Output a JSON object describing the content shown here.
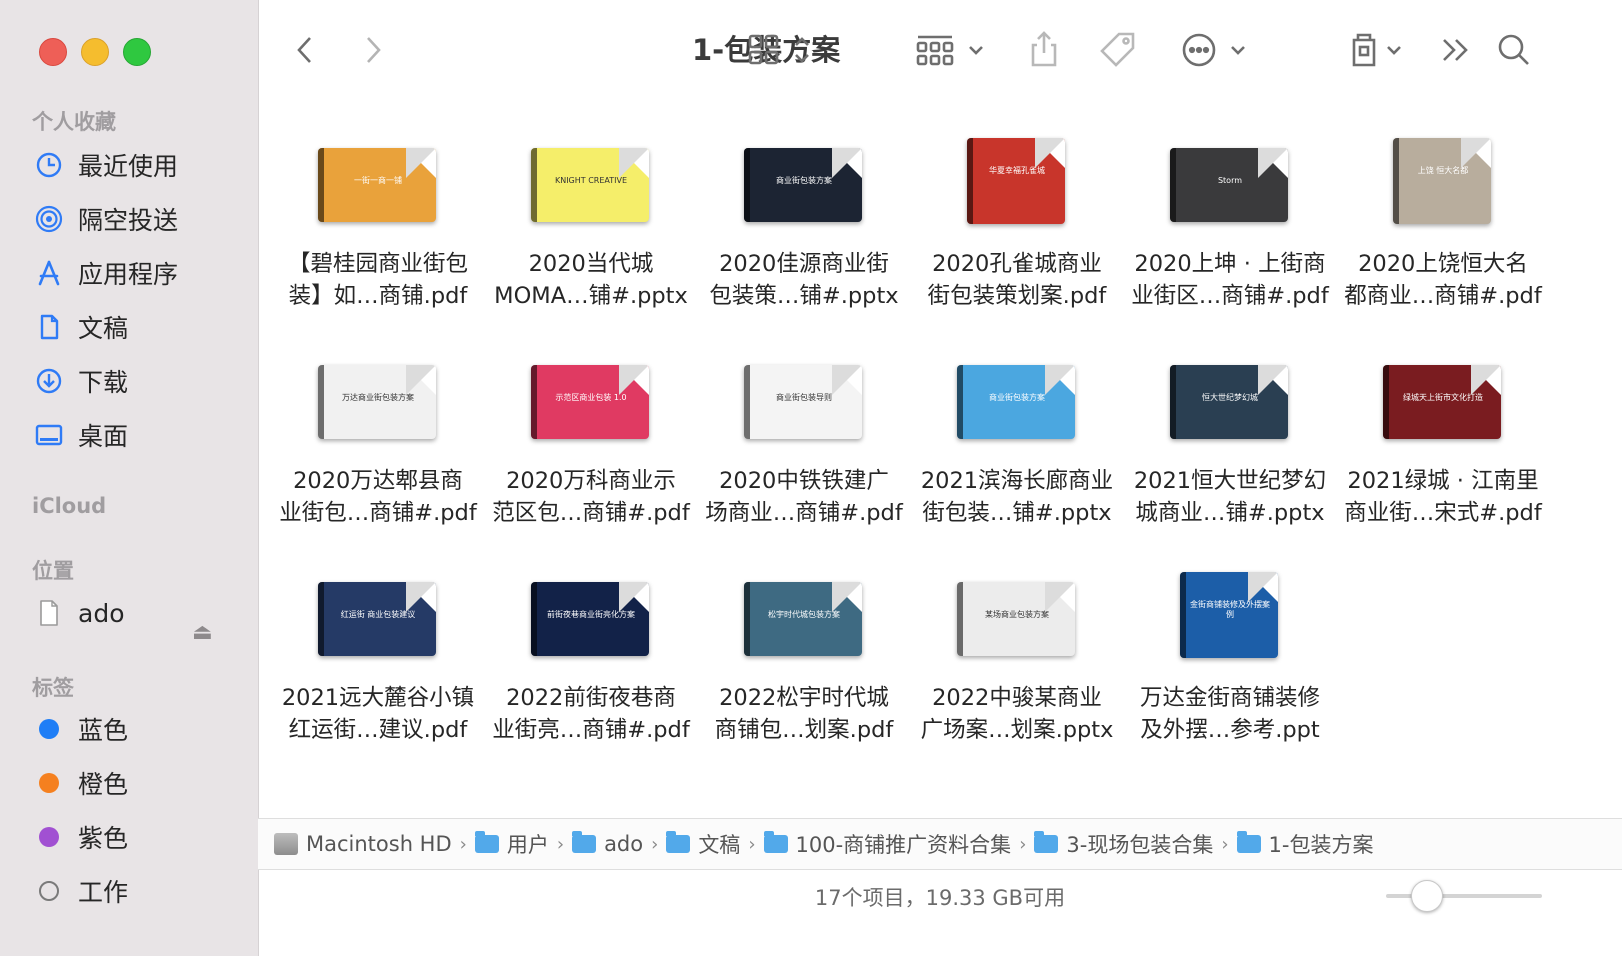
{
  "window": {
    "title": "1-包装方案"
  },
  "sidebar": {
    "favorites_title": "个人收藏",
    "favorites": [
      {
        "label": "最近使用",
        "icon": "clock-icon"
      },
      {
        "label": "隔空投送",
        "icon": "airdrop-icon"
      },
      {
        "label": "应用程序",
        "icon": "applications-icon"
      },
      {
        "label": "文稿",
        "icon": "document-icon"
      },
      {
        "label": "下载",
        "icon": "download-icon"
      },
      {
        "label": "桌面",
        "icon": "desktop-icon"
      }
    ],
    "icloud_title": "iCloud",
    "locations_title": "位置",
    "locations": [
      {
        "label": "ado",
        "icon": "file-icon"
      }
    ],
    "tags_title": "标签",
    "tags": [
      {
        "label": "蓝色",
        "color": "#1f7ef6"
      },
      {
        "label": "橙色",
        "color": "#f5801f"
      },
      {
        "label": "紫色",
        "color": "#a150d2"
      },
      {
        "label": "工作",
        "color": "none"
      }
    ]
  },
  "files": [
    {
      "line1": "【碧桂园商业街包",
      "line2": "装】如…商铺.pdf",
      "thumb_bg": "#e9a23b",
      "thumb_text": "一街一商一铺"
    },
    {
      "line1": "2020当代城",
      "line2": "MOMA…铺#.pptx",
      "thumb_bg": "#f5ee6a",
      "thumb_text": "KNIGHT CREATIVE"
    },
    {
      "line1": "2020佳源商业街",
      "line2": "包装策…铺#.pptx",
      "thumb_bg": "#1c2433",
      "thumb_text": "商业街包装方案"
    },
    {
      "line1": "2020孔雀城商业",
      "line2": "街包装策划案.pdf",
      "thumb_bg": "#c8352b",
      "thumb_text": "华夏幸福孔雀城"
    },
    {
      "line1": "2020上坤 · 上街商",
      "line2": "业街区…商铺#.pdf",
      "thumb_bg": "#3a3a3c",
      "thumb_text": "Storm"
    },
    {
      "line1": "2020上饶恒大名",
      "line2": "都商业…商铺#.pdf",
      "thumb_bg": "#b8ad9d",
      "thumb_text": "上饶 恒大名都"
    },
    {
      "line1": "2020万达郫县商",
      "line2": "业街包…商铺#.pdf",
      "thumb_bg": "#f1f1f1",
      "thumb_text": "万达商业街包装方案"
    },
    {
      "line1": "2020万科商业示",
      "line2": "范区包…商铺#.pdf",
      "thumb_bg": "#e03a62",
      "thumb_text": "示范区商业包装 1.0"
    },
    {
      "line1": "2020中铁铁建广",
      "line2": "场商业…商铺#.pdf",
      "thumb_bg": "#f4f4f4",
      "thumb_text": "商业街包装导则"
    },
    {
      "line1": "2021滨海长廊商业",
      "line2": "街包装…铺#.pptx",
      "thumb_bg": "#4ba7e0",
      "thumb_text": "商业街包装方案"
    },
    {
      "line1": "2021恒大世纪梦幻",
      "line2": "城商业…铺#.pptx",
      "thumb_bg": "#2a3f52",
      "thumb_text": "恒大世纪梦幻城"
    },
    {
      "line1": "2021绿城 · 江南里",
      "line2": "商业街…宋式#.pdf",
      "thumb_bg": "#7a1c20",
      "thumb_text": "绿城天上街市文化打造"
    },
    {
      "line1": "2021远大麓谷小镇",
      "line2": "红运街…建议.pdf",
      "thumb_bg": "#253a66",
      "thumb_text": "红运街 商业包装建议"
    },
    {
      "line1": "2022前街夜巷商",
      "line2": "业街亮…商铺#.pdf",
      "thumb_bg": "#122248",
      "thumb_text": "前街夜巷商业街亮化方案"
    },
    {
      "line1": "2022松宇时代城",
      "line2": "商铺包…划案.pdf",
      "thumb_bg": "#3e6a82",
      "thumb_text": "松宇时代城包装方案"
    },
    {
      "line1": "2022中骏某商业",
      "line2": "广场案…划案.pptx",
      "thumb_bg": "#ececec",
      "thumb_text": "某场商业包装方案"
    },
    {
      "line1": "万达金街商铺装修",
      "line2": "及外摆…参考.ppt",
      "thumb_bg": "#1c5ea8",
      "thumb_text": "金街商铺装修及外摆案例"
    }
  ],
  "pathbar": {
    "crumbs": [
      "Macintosh HD",
      "用户",
      "ado",
      "文稿",
      "100-商铺推广资料合集",
      "3-现场包装合集",
      "1-包装方案"
    ]
  },
  "status": {
    "text": "17个项目，19.33 GB可用",
    "icon_size_fraction": 0.2
  }
}
